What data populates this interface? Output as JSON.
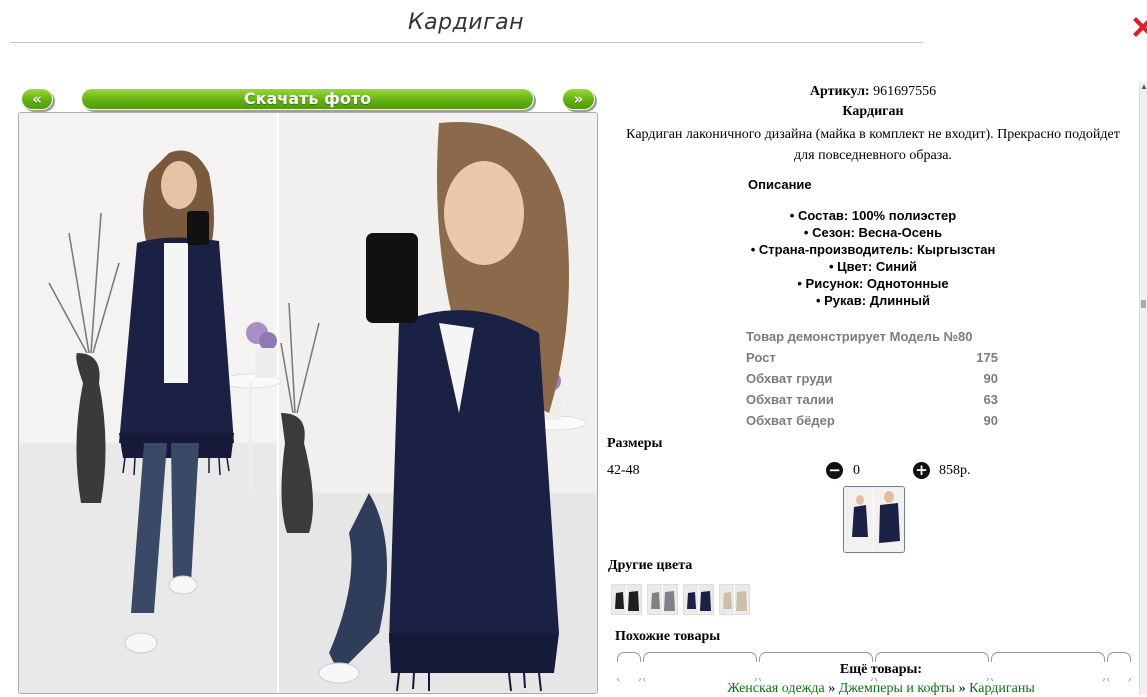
{
  "header": {
    "title": "Кардиган"
  },
  "gallery": {
    "prev_label": "«",
    "download_label": "Скачать фото",
    "next_label": "»"
  },
  "product": {
    "article_label": "Артикул:",
    "article_value": "961697556",
    "name": "Кардиган",
    "description": "Кардиган лаконичного дизайна (майка в комплект не входит). Прекрасно подойдет для повседневного образа.",
    "details_heading": "Описание",
    "attributes": [
      "• Состав: 100% полиэстер",
      "• Сезон: Весна-Осень",
      "• Страна-производитель: Кыргызстан",
      "• Цвет: Синий",
      "• Рисунок: Однотонные",
      "• Рукав: Длинный"
    ],
    "model": {
      "heading": "Товар демонстрирует Модель №80",
      "rows": [
        {
          "label": "Рост",
          "value": "175"
        },
        {
          "label": "Обхват груди",
          "value": "90"
        },
        {
          "label": "Обхват талии",
          "value": "63"
        },
        {
          "label": "Обхват бёдер",
          "value": "90"
        }
      ]
    }
  },
  "sizes": {
    "heading": "Размеры",
    "size": "42-48",
    "quantity": "0",
    "price": "858р."
  },
  "other_colors": {
    "heading": "Другие цвета"
  },
  "similar": {
    "heading": "Похожие товары"
  },
  "more": {
    "heading": "Ещё товары:",
    "crumb_1": "Женская одежда",
    "sep": "»",
    "crumb_2": "Джемперы и кофты",
    "crumb_3": "Кардиганы"
  },
  "colors": {
    "accent_green": "#64b012",
    "cardigan_navy": "#1b2045",
    "link_green": "#107010",
    "close_red": "#d8222a"
  }
}
